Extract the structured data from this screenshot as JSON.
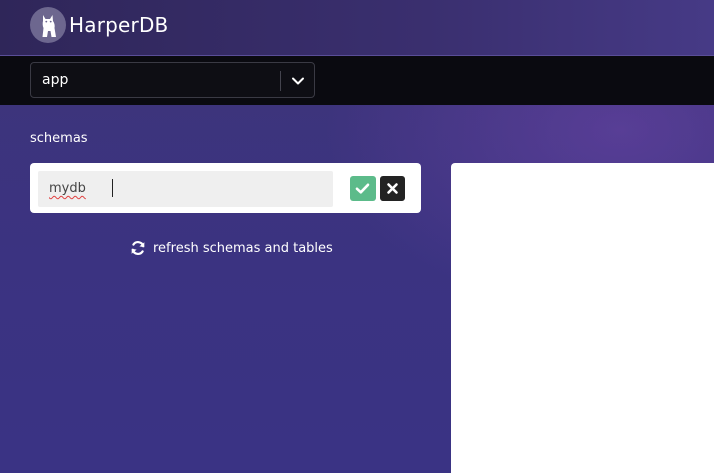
{
  "header": {
    "logo_text": "HarperDB",
    "logo_icon": "harperdb-dog-logo-icon"
  },
  "toolbar": {
    "app_select": {
      "value": "app",
      "icon": "chevron-down-icon"
    }
  },
  "schemas": {
    "label": "schemas",
    "input_value": "mydb",
    "confirm_icon": "check-icon",
    "cancel_icon": "close-icon",
    "refresh_label": "refresh schemas and tables",
    "refresh_icon": "refresh-icon"
  },
  "colors": {
    "background": "#3d3379",
    "toolbar": "#0a0a10",
    "confirm": "#5cbb8a",
    "cancel": "#232323"
  }
}
